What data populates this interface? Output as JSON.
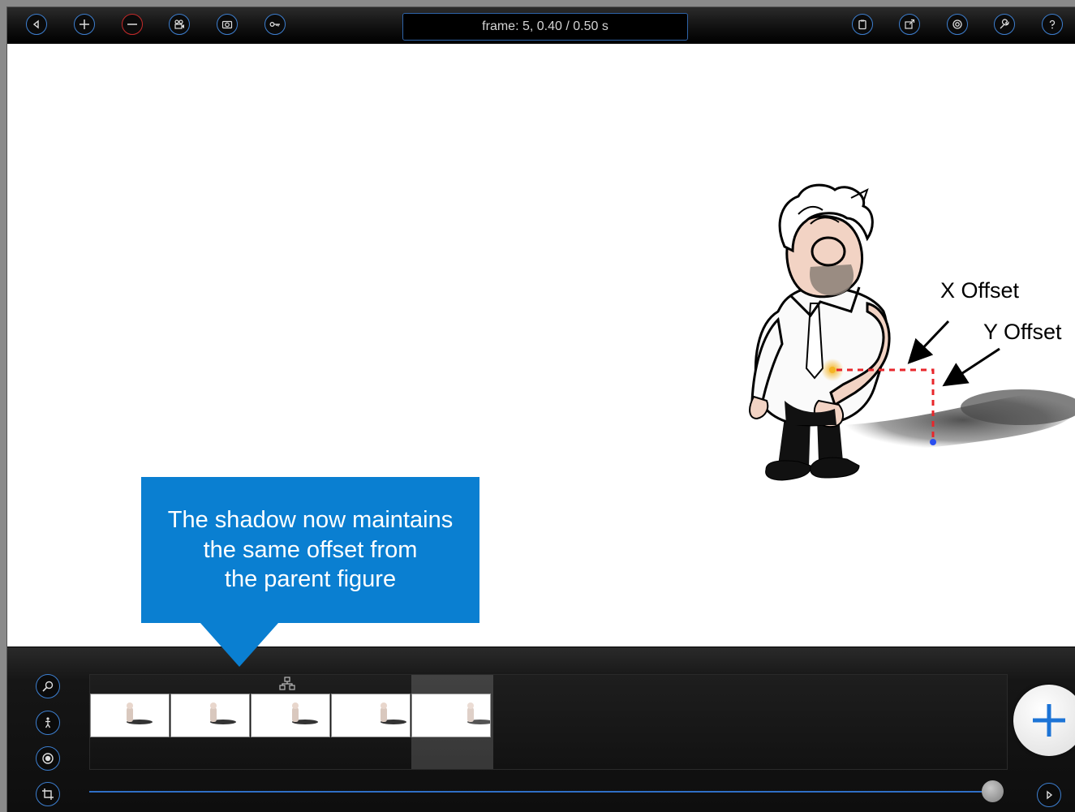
{
  "toolbar": {
    "frame_readout": "frame: 5, 0.40 / 0.50 s",
    "left_buttons": [
      "back-icon",
      "add-icon",
      "minus-icon",
      "movie-camera-icon",
      "camera-icon",
      "key-icon"
    ],
    "right_buttons": [
      "clipboard-icon",
      "export-icon",
      "settings-icon",
      "wrench-icon",
      "help-icon"
    ]
  },
  "canvas": {
    "annotations": {
      "x_offset": "X Offset",
      "y_offset": "Y Offset"
    },
    "callout": {
      "line1": "The shadow now maintains",
      "line2": "the same offset from",
      "line3": "the parent figure"
    }
  },
  "timeline": {
    "frame_count": 5,
    "selected_frame": 5,
    "side_buttons": [
      "zoom-icon",
      "figure-icon",
      "onion-skin-icon",
      "crop-icon"
    ]
  },
  "colors": {
    "accent_blue": "#0a7fd1",
    "toolbar_ring": "#3d7fd0",
    "delete_ring": "#c62a2a",
    "offset_line": "#e8262b"
  }
}
